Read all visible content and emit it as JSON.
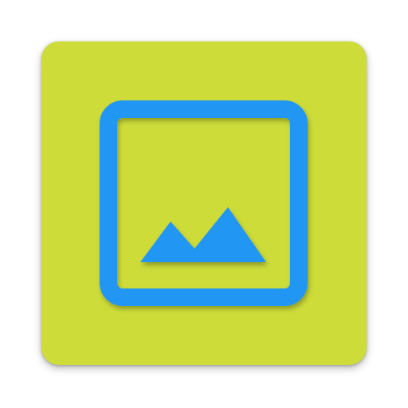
{
  "icon": {
    "name": "gallery-app-icon",
    "glyph": "image-icon",
    "colors": {
      "background": "#cddc39",
      "foreground": "#2196f3"
    }
  }
}
